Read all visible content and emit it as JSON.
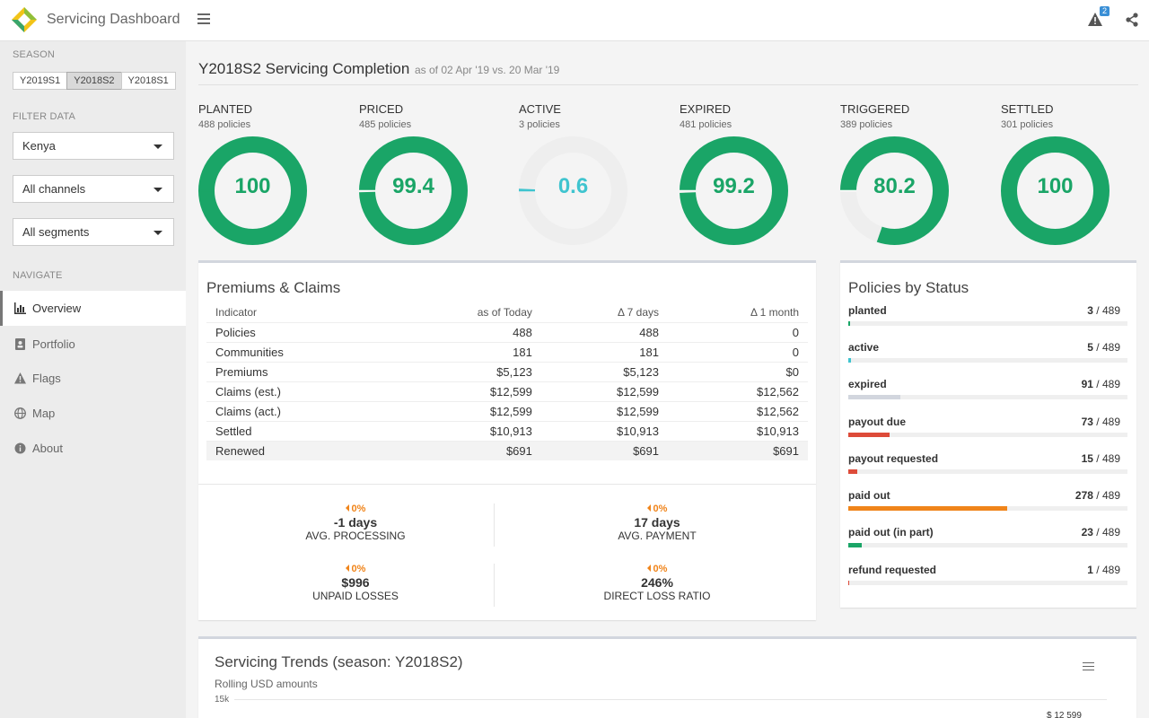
{
  "app": {
    "title": "Servicing Dashboard",
    "alert_count": "2"
  },
  "colors": {
    "green": "#1aa567",
    "cyan": "#3fc4cf",
    "gray": "#d2d6de",
    "red": "#dd4b39",
    "orange": "#f0841a",
    "track": "#eeeeee",
    "badge": "#3a8fd6"
  },
  "sidebar": {
    "season_label": "SEASON",
    "seasons": [
      "Y2019S1",
      "Y2018S2",
      "Y2018S1"
    ],
    "selected_season": "Y2018S2",
    "filter_label": "FILTER DATA",
    "filters": {
      "country": "Kenya",
      "channel": "All channels",
      "segment": "All segments"
    },
    "navigate_label": "NAVIGATE",
    "nav": [
      {
        "label": "Overview",
        "icon": "bar-chart-icon",
        "active": true
      },
      {
        "label": "Portfolio",
        "icon": "address-book-icon",
        "active": false
      },
      {
        "label": "Flags",
        "icon": "warning-icon",
        "active": false
      },
      {
        "label": "Map",
        "icon": "globe-icon",
        "active": false
      },
      {
        "label": "About",
        "icon": "info-circle-icon",
        "active": false
      }
    ]
  },
  "main": {
    "title": "Y2018S2 Servicing Completion",
    "subtitle": "as of 02 Apr '19 vs. 20 Mar '19",
    "gauges": [
      {
        "label": "PLANTED",
        "sub": "488 policies",
        "value": 100,
        "display": "100",
        "color": "green"
      },
      {
        "label": "PRICED",
        "sub": "485 policies",
        "value": 99.4,
        "display": "99.4",
        "color": "green"
      },
      {
        "label": "ACTIVE",
        "sub": "3 policies",
        "value": 0.6,
        "display": "0.6",
        "color": "cyan"
      },
      {
        "label": "EXPIRED",
        "sub": "481 policies",
        "value": 99.2,
        "display": "99.2",
        "color": "green"
      },
      {
        "label": "TRIGGERED",
        "sub": "389 policies",
        "value": 80.2,
        "display": "80.2",
        "color": "green"
      },
      {
        "label": "SETTLED",
        "sub": "301 policies",
        "value": 100,
        "display": "100",
        "color": "green"
      }
    ]
  },
  "premiums": {
    "title": "Premiums & Claims",
    "headers": [
      "Indicator",
      "as of Today",
      "Δ 7 days",
      "Δ 1 month"
    ],
    "rows": [
      [
        "Policies",
        "488",
        "488",
        "0"
      ],
      [
        "Communities",
        "181",
        "181",
        "0"
      ],
      [
        "Premiums",
        "$5,123",
        "$5,123",
        "$0"
      ],
      [
        "Claims (est.)",
        "$12,599",
        "$12,599",
        "$12,562"
      ],
      [
        "Claims (act.)",
        "$12,599",
        "$12,599",
        "$12,562"
      ],
      [
        "Settled",
        "$10,913",
        "$10,913",
        "$10,913"
      ],
      [
        "Renewed",
        "$691",
        "$691",
        "$691"
      ]
    ],
    "kpis": [
      {
        "delta": "0%",
        "value": "-1 days",
        "label": "AVG. PROCESSING"
      },
      {
        "delta": "0%",
        "value": "17 days",
        "label": "AVG. PAYMENT"
      },
      {
        "delta": "0%",
        "value": "$996",
        "label": "UNPAID LOSSES"
      },
      {
        "delta": "0%",
        "value": "246%",
        "label": "DIRECT LOSS RATIO"
      }
    ]
  },
  "status": {
    "title": "Policies by Status",
    "total": 489,
    "items": [
      {
        "name": "planted",
        "count": 3,
        "of": "/ 489",
        "color": "green"
      },
      {
        "name": "active",
        "count": 5,
        "of": "/ 489",
        "color": "cyan"
      },
      {
        "name": "expired",
        "count": 91,
        "of": "/ 489",
        "color": "gray"
      },
      {
        "name": "payout due",
        "count": 73,
        "of": "/ 489",
        "color": "red"
      },
      {
        "name": "payout requested",
        "count": 15,
        "of": "/ 489",
        "color": "red"
      },
      {
        "name": "paid out",
        "count": 278,
        "of": "/ 489",
        "color": "orange"
      },
      {
        "name": "paid out (in part)",
        "count": 23,
        "of": "/ 489",
        "color": "green"
      },
      {
        "name": "refund requested",
        "count": 1,
        "of": "/ 489",
        "color": "red"
      }
    ]
  },
  "trends": {
    "title": "Servicing Trends (season: Y2018S2)",
    "subtitle": "Rolling USD amounts",
    "y_tick": "15k",
    "last_value": "$ 12 599"
  }
}
